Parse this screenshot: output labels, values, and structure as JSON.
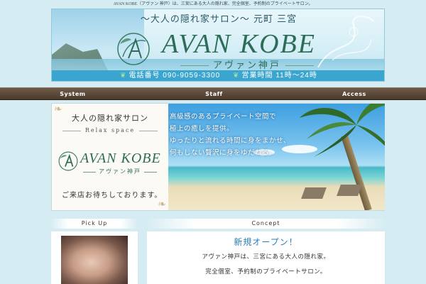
{
  "top_notice": "AVAN KOBE（アヴァン 神戸）は、三宮にある大人の隠れ家、完全個室、予約制のプライベートサロン。",
  "banner": {
    "tagline": "〜大人の隠れ家サロン〜 元町 三宮",
    "logo": "AVAN KOBE",
    "logo_sub": "アヴァン神戸",
    "phone_label": "電話番号 090-9059-3300",
    "hours_label": "営業時間 11時〜24時"
  },
  "nav": {
    "items": [
      "System",
      "Staff",
      "Access"
    ]
  },
  "hero": {
    "left_title": "大人の隠れ家サロン",
    "left_sub": "Relax space",
    "logo": "AVAN KOBE",
    "logo_sub": "アヴァン神戸",
    "welcome": "ご来店お待ちしております。",
    "copy": [
      "高級感のあるプライベート空間で",
      "極上の癒しを提供。",
      "ゆったりと流れる時間に身をまかせ、",
      "何もしない贅沢に身をゆだねる。"
    ]
  },
  "pickup": {
    "heading": "Pick Up"
  },
  "concept": {
    "heading": "Concept",
    "title": "新規オープン！",
    "lines": [
      "アヴァン神戸は、三宮にある大人の隠れ家。",
      "完全個室、予約制のプライベートサロン。"
    ]
  },
  "colors": {
    "background": "#d6ecf3",
    "nav": "#4a3a2c",
    "brand_green": "#2d6d58",
    "info_bar": "#3aa6cf",
    "concept_title": "#2a7fb8"
  }
}
